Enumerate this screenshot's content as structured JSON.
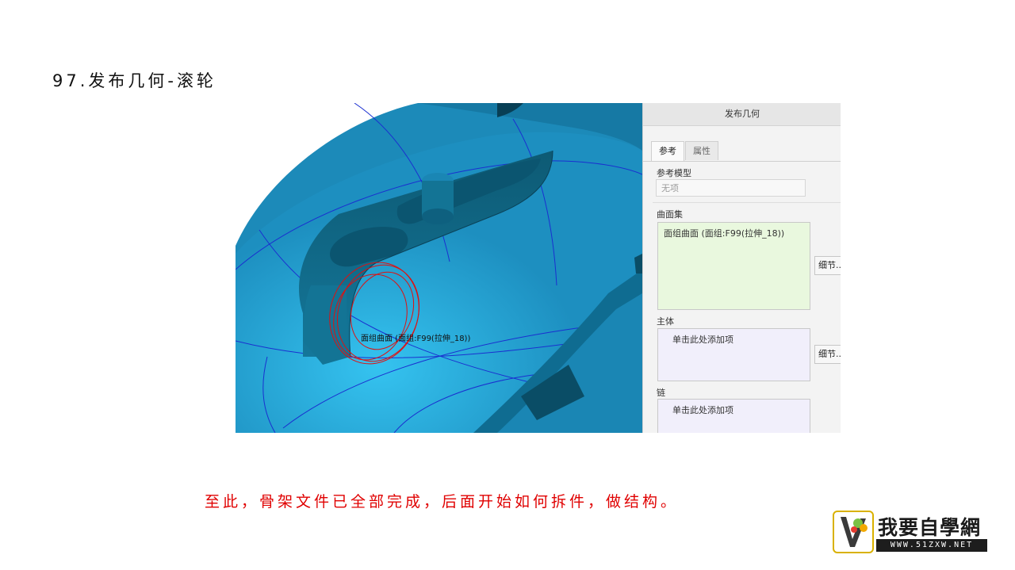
{
  "slide": {
    "title": "97.发布几何-滚轮",
    "note": "至此，骨架文件已全部完成，后面开始如何拆件，做结构。"
  },
  "viewport": {
    "surface_annotation": "面组曲面 (面组:F99(拉伸_18))",
    "model_color": "#1d8fc0"
  },
  "dialog": {
    "title": "发布几何",
    "tabs": [
      {
        "label": "参考",
        "active": true
      },
      {
        "label": "属性",
        "active": false
      }
    ],
    "reference_model": {
      "label": "参考模型",
      "value": "无项"
    },
    "surface_sets": {
      "label": "曲面集",
      "items": [
        "面组曲面 (面组:F99(拉伸_18))"
      ],
      "details_button": "细节..."
    },
    "bodies": {
      "label": "主体",
      "placeholder": "单击此处添加项",
      "details_button": "细节..."
    },
    "chains": {
      "label": "链",
      "placeholder": "单击此处添加项"
    }
  },
  "logo": {
    "name": "我要自學網",
    "url": "WWW.51ZXW.NET"
  }
}
